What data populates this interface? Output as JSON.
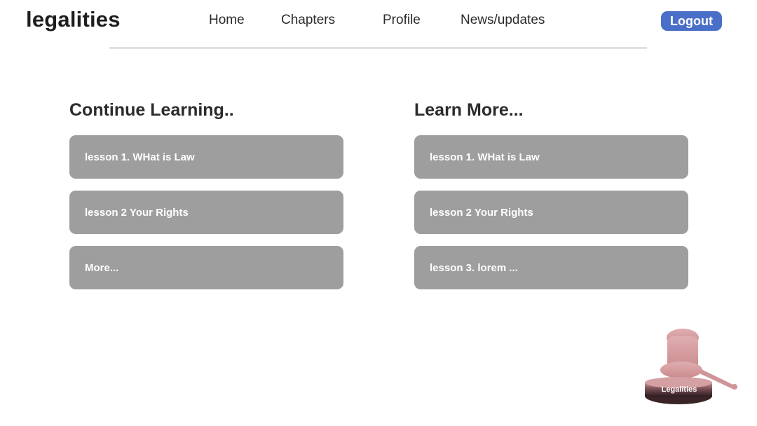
{
  "header": {
    "brand": "legalities",
    "nav": {
      "home": "Home",
      "chapters": "Chapters",
      "profile": "Profile",
      "news": "News/updates"
    },
    "logout_label": "Logout"
  },
  "continue_learning": {
    "title": "Continue Learning..",
    "items": [
      {
        "label": "lesson 1. WHat is Law"
      },
      {
        "label": "lesson 2 Your Rights"
      },
      {
        "label": "More..."
      }
    ]
  },
  "learn_more": {
    "title": "Learn More...",
    "items": [
      {
        "label": "lesson 1. WHat is Law"
      },
      {
        "label": "lesson 2 Your Rights"
      },
      {
        "label": "lesson 3. lorem ..."
      }
    ]
  },
  "logo": {
    "icon": "gavel-icon",
    "label": "Legalities"
  },
  "colors": {
    "accent": "#4a6fc8",
    "card": "#9f9e9f",
    "gavel": "#d6a1a3",
    "base": "#4a2f33"
  }
}
